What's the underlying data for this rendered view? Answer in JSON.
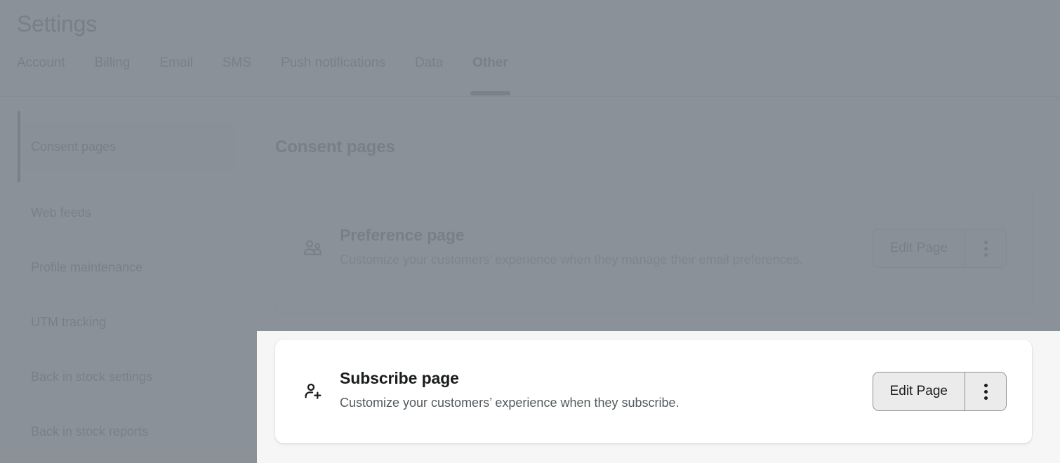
{
  "header": {
    "title": "Settings",
    "tabs": [
      {
        "label": "Account",
        "active": false
      },
      {
        "label": "Billing",
        "active": false
      },
      {
        "label": "Email",
        "active": false
      },
      {
        "label": "SMS",
        "active": false
      },
      {
        "label": "Push notifications",
        "active": false
      },
      {
        "label": "Data",
        "active": false
      },
      {
        "label": "Other",
        "active": true
      }
    ]
  },
  "sidebar": {
    "items": [
      {
        "label": "Consent pages",
        "selected": true
      },
      {
        "label": "Web feeds",
        "selected": false
      },
      {
        "label": "Profile maintenance",
        "selected": false
      },
      {
        "label": "UTM tracking",
        "selected": false
      },
      {
        "label": "Back in stock settings",
        "selected": false
      },
      {
        "label": "Back in stock reports",
        "selected": false
      }
    ]
  },
  "main": {
    "title": "Consent pages",
    "cards": [
      {
        "icon": "two-people-icon",
        "heading": "Preference page",
        "description": "Customize your customers’ experience when they manage their email preferences.",
        "primary_label": "Edit Page",
        "more_label": "more-actions"
      },
      {
        "icon": "person-add-icon",
        "heading": "Subscribe page",
        "description": "Customize your customers’ experience when they subscribe.",
        "primary_label": "Edit Page",
        "more_label": "more-actions"
      }
    ]
  },
  "colors": {
    "accent": "#303538",
    "text": "#1a1c1d",
    "muted_text": "#53595d",
    "surface": "#ffffff",
    "page_bg": "#f6f6f7",
    "selected_bg": "#ebebeb",
    "border": "#8a8f94",
    "dim_overlay": "#808890"
  }
}
